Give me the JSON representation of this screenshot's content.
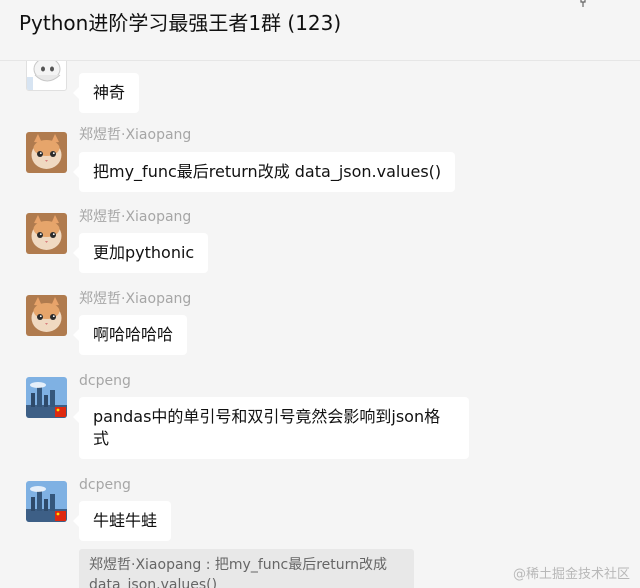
{
  "header": {
    "title": "Python进阶学习最强王者1群 (123)"
  },
  "messages": [
    {
      "sender": "",
      "text": "神奇"
    },
    {
      "sender": "郑煜哲·Xiaopang",
      "text": "把my_func最后return改成 data_json.values()"
    },
    {
      "sender": "郑煜哲·Xiaopang",
      "text": "更加pythonic"
    },
    {
      "sender": "郑煜哲·Xiaopang",
      "text": "啊哈哈哈哈"
    },
    {
      "sender": "dcpeng",
      "text": "pandas中的单引号和双引号竟然会影响到json格式"
    },
    {
      "sender": "dcpeng",
      "text": "牛蛙牛蛙"
    }
  ],
  "quote": {
    "text": "郑煜哲·Xiaopang : 把my_func最后return改成 data_json.values()"
  },
  "watermark": "@稀土掘金技术社区",
  "colors": {
    "background": "#f5f5f5",
    "bubble": "#ffffff",
    "sender_name": "#a6a6a6",
    "quote_bg": "#e8e8e8"
  },
  "icons": [
    "pin-icon",
    "cartoon-sticker-avatar",
    "cat-avatar",
    "city-avatar",
    "china-flag-badge"
  ]
}
